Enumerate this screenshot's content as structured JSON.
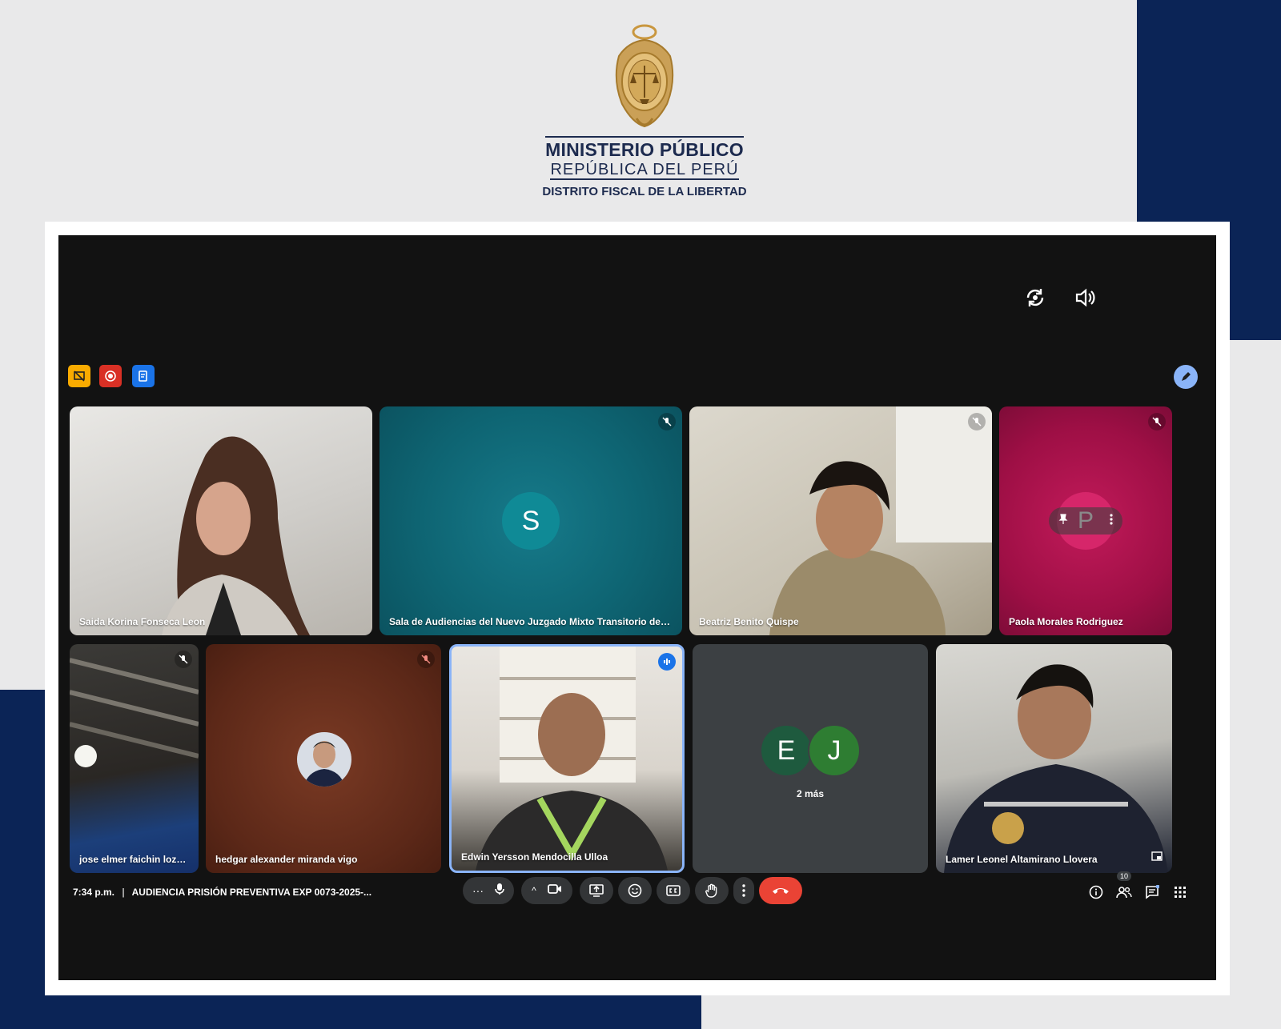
{
  "branding": {
    "org_name": "MINISTERIO PÚBLICO",
    "org_country": "REPÚBLICA DEL PERÚ",
    "org_district": "DISTRITO FISCAL DE LA LIBERTAD"
  },
  "meeting": {
    "time": "7:34 p.m.",
    "title": "AUDIENCIA PRISIÓN PREVENTIVA EXP 0073-2025-...",
    "participants_count": "10",
    "hidden_participants_label": "2 más"
  },
  "participants": [
    {
      "name": "Saida Korina Fonseca Leon"
    },
    {
      "name": "Sala de Audiencias del Nuevo Juzgado Mixto Transitorio de Par...",
      "initial": "S"
    },
    {
      "name": "Beatriz Benito Quispe"
    },
    {
      "name": "Paola Morales Rodriguez",
      "initial": "P"
    },
    {
      "name": "jose elmer faichin loza..."
    },
    {
      "name": "hedgar alexander miranda vigo"
    },
    {
      "name": "Edwin Yersson Mendocilla Ulloa"
    },
    {
      "initials": [
        "E",
        "J"
      ]
    },
    {
      "name": "Lamer Leonel Altamirano Llovera"
    }
  ],
  "colors": {
    "brand_navy": "#0b2456",
    "meet_bg": "#121212",
    "end_call": "#ea4335",
    "teal_tile": "#0f6b7a",
    "magenta_tile": "#a01047",
    "brown_tile": "#6a2e1d"
  }
}
